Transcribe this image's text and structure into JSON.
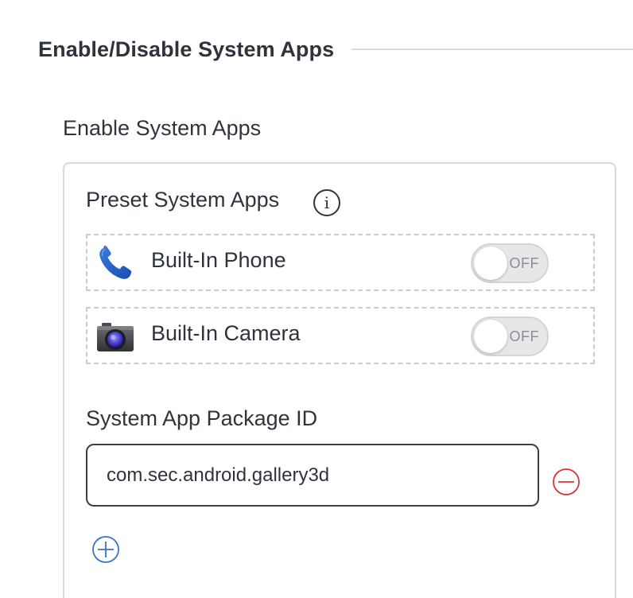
{
  "section": {
    "title": "Enable/Disable System Apps"
  },
  "subsection": {
    "title": "Enable System Apps"
  },
  "preset": {
    "label": "Preset System Apps",
    "info_glyph": "i",
    "apps": [
      {
        "label": "Built-In Phone",
        "icon": "phone-icon",
        "toggle_text": "OFF",
        "enabled": false
      },
      {
        "label": "Built-In Camera",
        "icon": "camera-icon",
        "toggle_text": "OFF",
        "enabled": false
      }
    ]
  },
  "package": {
    "label": "System App Package ID",
    "value": "com.sec.android.gallery3d"
  },
  "icons": {
    "remove": "minus-circle-icon",
    "add": "plus-circle-icon",
    "info": "info-icon"
  },
  "colors": {
    "text": "#2f343c",
    "remove_red": "#d9343a",
    "add_blue": "#3d72c4",
    "toggle_bg": "#e6e7e9"
  }
}
